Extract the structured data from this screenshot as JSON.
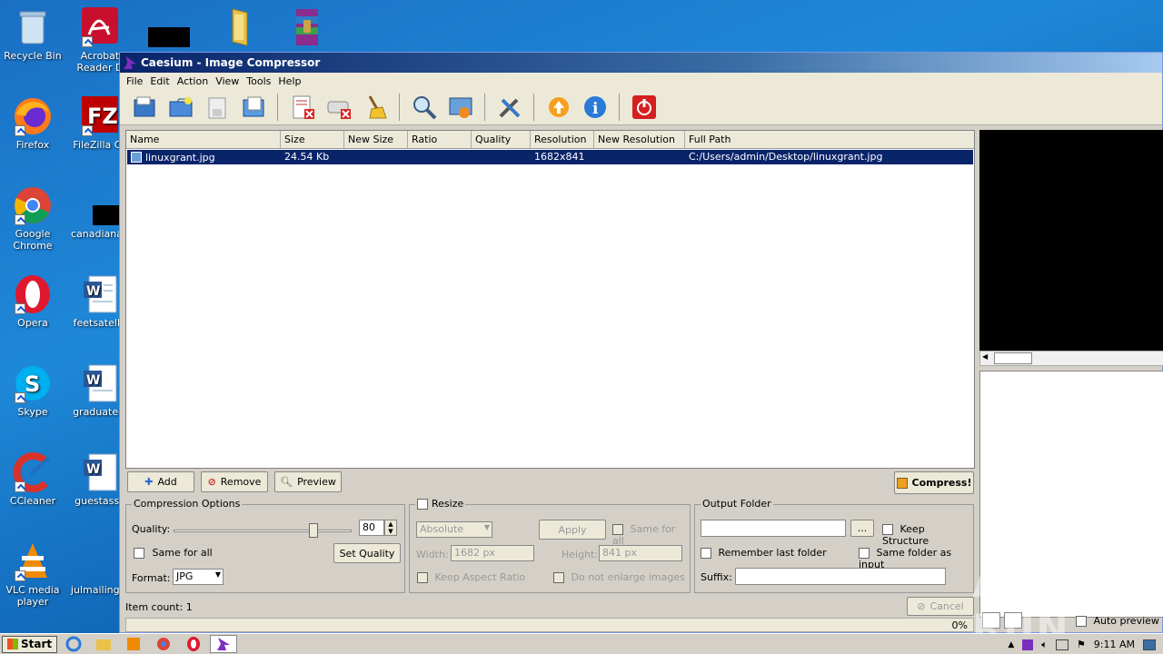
{
  "desktop": {
    "icons": [
      {
        "label": "Recycle Bin"
      },
      {
        "label": "Acrobat Reader D"
      },
      {
        "label": "Firefox"
      },
      {
        "label": "FileZilla Cli"
      },
      {
        "label": "Google Chrome"
      },
      {
        "label": "canadianan"
      },
      {
        "label": "Opera"
      },
      {
        "label": "feetsatellit"
      },
      {
        "label": "Skype"
      },
      {
        "label": "graduateel"
      },
      {
        "label": "CCleaner"
      },
      {
        "label": "guestasso"
      },
      {
        "label": "VLC media player"
      },
      {
        "label": "julmailing.p"
      }
    ]
  },
  "window": {
    "title": "Caesium - Image Compressor",
    "menu": [
      "File",
      "Edit",
      "Action",
      "View",
      "Tools",
      "Help"
    ],
    "toolbar": [
      "open-icon",
      "open-folder-icon",
      "save-list-icon",
      "clear-icon",
      "remove-icon",
      "clear-list-icon",
      "clean-icon",
      "search-icon",
      "preview-icon",
      "settings-icon",
      "update-icon",
      "info-icon",
      "power-icon"
    ],
    "list": {
      "columns": [
        "Name",
        "Size",
        "New Size",
        "Ratio",
        "Quality",
        "Resolution",
        "New Resolution",
        "Full Path"
      ],
      "rows": [
        {
          "name": "linuxgrant.jpg",
          "size": "24.54 Kb",
          "new_size": "",
          "ratio": "",
          "quality": "",
          "resolution": "1682x841",
          "new_resolution": "",
          "full_path": "C:/Users/admin/Desktop/linuxgrant.jpg"
        }
      ]
    },
    "buttons": {
      "add": "Add",
      "remove": "Remove",
      "preview": "Preview",
      "compress": "Compress!",
      "cancel": "Cancel"
    },
    "compression": {
      "title": "Compression Options",
      "quality_label": "Quality:",
      "quality_value": "80",
      "quality_fraction": 0.8,
      "same_for_all": "Same for all",
      "set_quality": "Set Quality",
      "format_label": "Format:",
      "format_value": "JPG"
    },
    "resize": {
      "title": "Resize",
      "mode": "Absolute",
      "apply": "Apply",
      "same_for_all": "Same for all",
      "width_label": "Width:",
      "width_value": "1682 px",
      "height_label": "Height:",
      "height_value": "841 px",
      "keep_aspect": "Keep Aspect Ratio",
      "no_enlarge": "Do not enlarge images"
    },
    "output": {
      "title": "Output Folder",
      "browse": "...",
      "keep_structure": "Keep Structure",
      "remember_last": "Remember last folder",
      "same_as_input": "Same folder as input",
      "suffix_label": "Suffix:"
    },
    "status": {
      "item_count": "Item count: 1",
      "progress": "0%",
      "auto_preview": "Auto preview"
    }
  },
  "taskbar": {
    "start": "Start",
    "time": "9:11 AM"
  },
  "watermark": "ANY RUN"
}
